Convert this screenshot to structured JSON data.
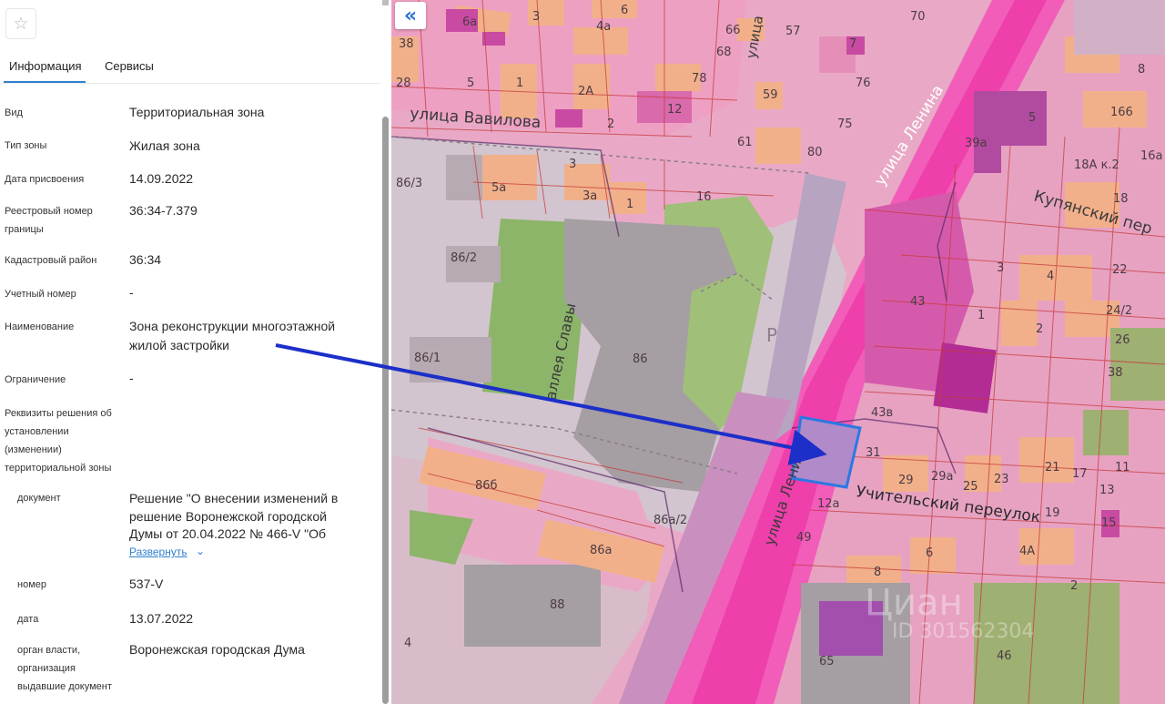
{
  "panel": {
    "star_icon": "☆",
    "tabs": {
      "info": "Информация",
      "services": "Сервисы"
    },
    "rows": {
      "vid": {
        "label": "Вид",
        "value": "Территориальная зона"
      },
      "zone_type": {
        "label": "Тип зоны",
        "value": "Жилая зона"
      },
      "date_assigned": {
        "label": "Дата присвоения",
        "value": "14.09.2022"
      },
      "registry_number": {
        "label_1": "Реестровый номер",
        "label_2": "границы",
        "value": "36:34-7.379"
      },
      "cadastral_district": {
        "label": "Кадастровый район",
        "value": "36:34"
      },
      "account_number": {
        "label": "Учетный номер",
        "value": "-"
      },
      "name": {
        "label": "Наименование",
        "value_1": "Зона реконструкции многоэтажной",
        "value_2": "жилой застройки"
      },
      "restriction": {
        "label": "Ограничение",
        "value": "-"
      },
      "decision": {
        "label_1": "Реквизиты решения об",
        "label_2": "установлении",
        "label_3": "(изменении)",
        "label_4": "территориальной зоны"
      },
      "document": {
        "label": "документ",
        "value_1": "Решение \"О внесении изменений в",
        "value_2": "решение Воронежской городской",
        "value_3": "Думы от 20.04.2022 № 466-V \"Об",
        "expand": "Развернуть",
        "chevron": "⌄"
      },
      "number": {
        "label": "номер",
        "value": "537-V"
      },
      "date": {
        "label": "дата",
        "value": "13.07.2022"
      },
      "authority": {
        "label_1": "орган власти,",
        "label_2": "организация",
        "label_3": "выдавшие документ",
        "value": "Воронежская городская Дума"
      }
    }
  },
  "map": {
    "collapse_icon": "«",
    "streets": {
      "vavilova": "улица Вавилова",
      "lenina_top": "улица Ленина",
      "lenina_bottom": "улица Ленина",
      "kupyansky": "Купянский пер",
      "uchitelsky": "Учительский переулок",
      "alleya": "аллея Славы",
      "left_vertical": "улица"
    },
    "house_numbers": {
      "h38": "38",
      "h6a": "6а",
      "h3": "3",
      "h6": "6",
      "h4a": "4а",
      "h66": "66",
      "h57": "57",
      "h7": "7",
      "h70": "70",
      "h28": "28",
      "h5": "5",
      "h1": "1",
      "h2a": "2А",
      "h68": "68",
      "h78": "78",
      "h76": "76",
      "h8": "8",
      "h59": "59",
      "h12": "12",
      "h2": "2",
      "h75": "75",
      "h61": "61",
      "h80": "80",
      "h5r": "5",
      "h39a": "39а",
      "h166": "166",
      "h18a": "18А к.2",
      "h16a": "16а",
      "h18": "18",
      "h86_3": "86/3",
      "h5a": "5а",
      "h3a": "3а",
      "h1b": "1",
      "h16": "16",
      "h3c": "3",
      "h86_2": "86/2",
      "h86_1": "86/1",
      "h86": "86",
      "h43": "43",
      "h3r": "3",
      "h4": "4",
      "h22": "22",
      "h24_2": "24/2",
      "h1r": "1",
      "h2r": "2",
      "h26": "26",
      "h38r": "38",
      "h43v": "43в",
      "h31": "31",
      "h29": "29",
      "h29a": "29а",
      "h25": "25",
      "h23": "23",
      "h21": "21",
      "h17": "17",
      "h11": "11",
      "h13": "13",
      "h19": "19",
      "h15": "15",
      "h866": "86б",
      "h86a_2": "86а/2",
      "h86a": "86а",
      "h12a": "12а",
      "h49": "49",
      "h6r": "6",
      "h8r": "8",
      "h4A": "4А",
      "h2b": "2",
      "h88": "88",
      "h65": "65",
      "h46": "46",
      "parking": "P",
      "hA": "4"
    },
    "watermark": {
      "brand": "Циан",
      "id": "ID 301562304"
    },
    "colors": {
      "zone_pink": "#e9a9c6",
      "road_magenta": "#ee4fb3",
      "parcel_orange": "#f2b08a",
      "building_gray": "#a59ea3",
      "park_green": "#8cb56a",
      "highlight_blue": "#2b78e4",
      "arrow_navy": "#1c2fc9"
    }
  }
}
